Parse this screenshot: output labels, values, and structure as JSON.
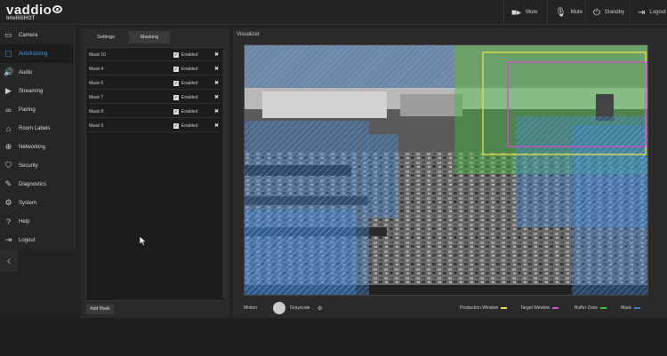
{
  "header": {
    "logo": "vaddio",
    "product": "IntelliSHOT",
    "buttons": [
      {
        "label": "Mute",
        "icon": "video-camera-icon"
      },
      {
        "label": "Mute",
        "icon": "microphone-icon"
      },
      {
        "label": "Standby",
        "icon": "power-icon"
      },
      {
        "label": "Logout",
        "icon": "logout-icon"
      }
    ]
  },
  "sidebar": {
    "items": [
      {
        "label": "Camera",
        "icon": "camera-icon",
        "active": false
      },
      {
        "label": "Autoframing",
        "icon": "autoframing-icon",
        "active": true
      },
      {
        "label": "Audio",
        "icon": "speaker-icon",
        "active": false
      },
      {
        "label": "Streaming",
        "icon": "play-icon",
        "active": false
      },
      {
        "label": "Pairing",
        "icon": "link-icon",
        "active": false
      },
      {
        "label": "Room Labels",
        "icon": "tag-icon",
        "active": false
      },
      {
        "label": "Networking",
        "icon": "network-icon",
        "active": false
      },
      {
        "label": "Security",
        "icon": "shield-icon",
        "active": false
      },
      {
        "label": "Diagnostics",
        "icon": "wrench-icon",
        "active": false
      },
      {
        "label": "System",
        "icon": "gear-icon",
        "active": false
      },
      {
        "label": "Help",
        "icon": "help-icon",
        "active": false
      },
      {
        "label": "Logout",
        "icon": "logout-icon",
        "active": false
      }
    ],
    "collapse_label": "‹"
  },
  "tabs": {
    "settings": "Settings",
    "masking": "Masking"
  },
  "masks": [
    {
      "name": "Mask 10",
      "enabled_label": "Enabled",
      "checked": true
    },
    {
      "name": "Mask 4",
      "enabled_label": "Enabled",
      "checked": true
    },
    {
      "name": "Mask 6",
      "enabled_label": "Enabled",
      "checked": true
    },
    {
      "name": "Mask 7",
      "enabled_label": "Enabled",
      "checked": true
    },
    {
      "name": "Mask 8",
      "enabled_label": "Enabled",
      "checked": true
    },
    {
      "name": "Mask 9",
      "enabled_label": "Enabled",
      "checked": true
    }
  ],
  "add_mask_label": "Add Mask",
  "visualizer": {
    "title": "Visualizer",
    "motion_label": "Motion",
    "grayscale_label": "Grayscale",
    "legend": [
      {
        "label": "Production Window",
        "color": "#e8e23a"
      },
      {
        "label": "Target Window",
        "color": "#d84bd8"
      },
      {
        "label": "Buffer Zone",
        "color": "#3cc23c"
      },
      {
        "label": "Mask",
        "color": "#3a7fd0"
      }
    ]
  },
  "colors": {
    "accent": "#3a9ee8",
    "production": "#e8e23a",
    "target": "#d84bd8",
    "buffer": "#3cc23c",
    "mask": "#3a7fd0"
  }
}
